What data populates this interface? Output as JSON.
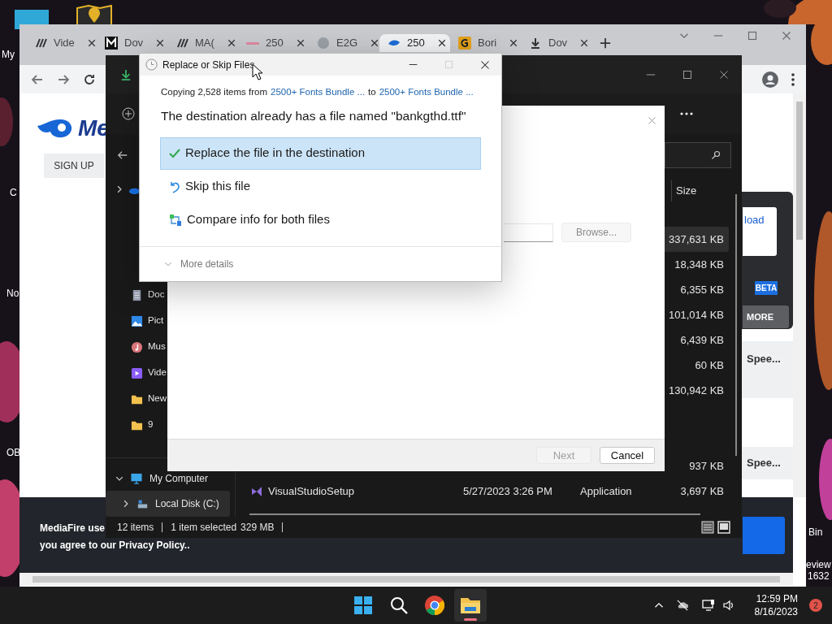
{
  "desktop": {
    "icon_labels": [
      "My",
      "C",
      "No",
      "OB",
      "Bin",
      "eview",
      "1632"
    ]
  },
  "browser": {
    "tabs": [
      {
        "label": "Vide",
        "selected": false
      },
      {
        "label": "Dov",
        "selected": false
      },
      {
        "label": "MA(",
        "selected": false
      },
      {
        "label": "250",
        "selected": false
      },
      {
        "label": "E2G",
        "selected": false
      },
      {
        "label": "250",
        "selected": true
      },
      {
        "label": "Bori",
        "selected": false
      },
      {
        "label": "Dov",
        "selected": false
      }
    ],
    "page": {
      "logo_text": "Me",
      "sign_up": "SIGN UP",
      "download_button": "load",
      "beta_badge": "BETA",
      "more_button": "MORE",
      "speed_labels": [
        "Spee...",
        "Spee..."
      ],
      "cookie_lines": [
        "MediaFire use",
        "you agree to our Privacy Policy.."
      ]
    }
  },
  "explorer": {
    "nav_items": [
      {
        "kind": "cloud",
        "expanded": false
      },
      {
        "kind": "documents",
        "label": "Doc"
      },
      {
        "kind": "pictures",
        "label": "Pict"
      },
      {
        "kind": "music",
        "label": "Mus"
      },
      {
        "kind": "videos",
        "label": "Vide"
      },
      {
        "kind": "folder",
        "label": "New"
      },
      {
        "kind": "folder",
        "label": "9"
      }
    ],
    "computer": {
      "label": "My Computer",
      "expanded": true,
      "children": [
        {
          "label": "Local Disk (C:)",
          "expanded": false,
          "selected": true
        }
      ]
    },
    "size_header": "Size",
    "rows": [
      {
        "size": "337,631 KB",
        "selected": true
      },
      {
        "size": "18,348 KB",
        "selected": false
      },
      {
        "size": "6,355 KB",
        "selected": false
      },
      {
        "size": "101,014 KB",
        "selected": false
      },
      {
        "size": "6,439 KB",
        "selected": false
      },
      {
        "size": "60 KB",
        "selected": false
      },
      {
        "size": "130,942 KB",
        "selected": false
      },
      {
        "selected": false
      },
      {
        "selected": false
      },
      {
        "size": "937 KB",
        "selected": false
      },
      {
        "name": "VisualStudioSetup",
        "date": "5/27/2023 3:26 PM",
        "type": "Application",
        "size": "3,697 KB",
        "selected": false
      }
    ],
    "status": [
      "12 items",
      "1 item selected",
      "329 MB"
    ]
  },
  "wizard": {
    "browse": {
      "label": "Browse...",
      "disabled": true
    },
    "next": {
      "label": "Next",
      "disabled": true
    },
    "cancel": {
      "label": "Cancel",
      "disabled": false
    }
  },
  "dialog": {
    "title": "Replace or Skip Files",
    "copying": "Copying 2,528 items from",
    "source": "2500+ Fonts Bundle ...",
    "to": "to",
    "destination": "2500+ Fonts Bundle ...",
    "message": "The destination already has a file named \"bankgthd.ttf\"",
    "options": [
      {
        "kind": "replace",
        "label": "Replace the file in the destination",
        "selected": true
      },
      {
        "kind": "skip",
        "label": "Skip this file",
        "selected": false
      },
      {
        "kind": "compare",
        "label": "Compare info for both files",
        "selected": false
      }
    ],
    "more_details": "More details"
  },
  "taskbar": {
    "apps": [
      {
        "kind": "start",
        "active": false
      },
      {
        "kind": "search",
        "active": false
      },
      {
        "kind": "chrome",
        "active": false
      },
      {
        "kind": "explorer",
        "active": true
      }
    ],
    "time": "12:59 PM",
    "date": "8/16/2023",
    "notifications": "2"
  }
}
